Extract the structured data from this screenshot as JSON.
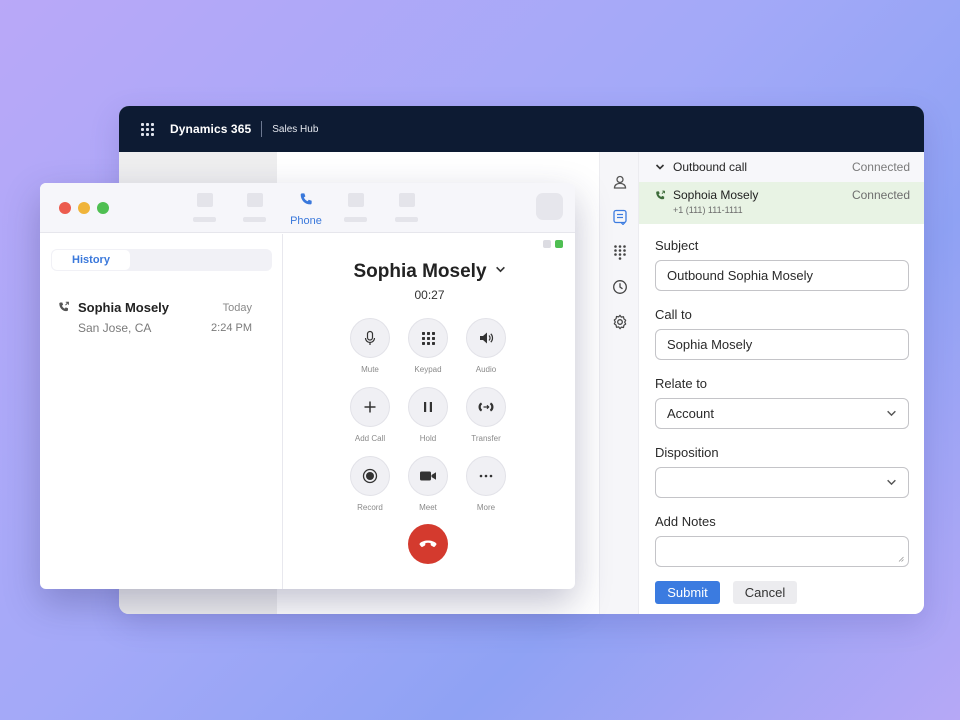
{
  "crm": {
    "app_name": "Dynamics 365",
    "module": "Sales Hub",
    "call_panel": {
      "header_title": "Outbound call",
      "header_status": "Connected",
      "contact_name": "Sophoia Mosely",
      "contact_status": "Connected",
      "contact_number": "+1 (111) 111-1111"
    },
    "form": {
      "subject_label": "Subject",
      "subject_value": "Outbound Sophia Mosely",
      "call_to_label": "Call to",
      "call_to_value": "Sophia Mosely",
      "relate_to_label": "Relate to",
      "relate_to_value": "Account",
      "disposition_label": "Disposition",
      "disposition_value": "",
      "notes_label": "Add Notes",
      "notes_value": "",
      "submit_label": "Submit",
      "cancel_label": "Cancel"
    },
    "icons": [
      "contact-icon",
      "notes-icon",
      "dialpad-icon",
      "history-icon",
      "settings-icon"
    ]
  },
  "phone": {
    "active_tab": "Phone",
    "history_tab": "History",
    "history": [
      {
        "name": "Sophia Mosely",
        "location": "San Jose, CA",
        "day": "Today",
        "time": "2:24 PM"
      }
    ],
    "caller_name": "Sophia Mosely",
    "call_timer": "00:27",
    "controls": [
      {
        "label": "Mute",
        "icon": "microphone-icon"
      },
      {
        "label": "Keypad",
        "icon": "keypad-icon"
      },
      {
        "label": "Audio",
        "icon": "speaker-icon"
      },
      {
        "label": "Add Call",
        "icon": "plus-icon"
      },
      {
        "label": "Hold",
        "icon": "pause-icon"
      },
      {
        "label": "Transfer",
        "icon": "transfer-icon"
      },
      {
        "label": "Record",
        "icon": "record-icon"
      },
      {
        "label": "Meet",
        "icon": "video-icon"
      },
      {
        "label": "More",
        "icon": "more-icon"
      }
    ]
  },
  "colors": {
    "accent": "#3b7be0",
    "topbar": "#0d1b33",
    "connected_bg": "#e8f3e4",
    "hangup": "#d43a2e"
  }
}
